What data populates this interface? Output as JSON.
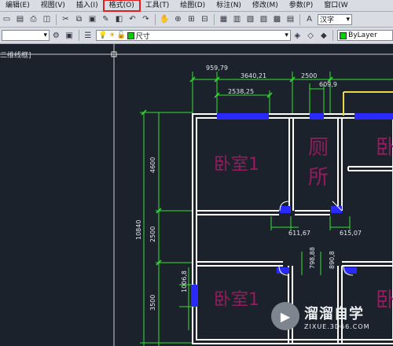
{
  "menu": {
    "items": [
      {
        "label": "编辑(E)"
      },
      {
        "label": "视图(V)"
      },
      {
        "label": "插入(I)"
      },
      {
        "label": "格式(O)"
      },
      {
        "label": "工具(T)"
      },
      {
        "label": "绘图(D)"
      },
      {
        "label": "标注(N)"
      },
      {
        "label": "修改(M)"
      },
      {
        "label": "参数(P)"
      },
      {
        "label": "窗口(W"
      }
    ]
  },
  "toolbar": {
    "text_style": "汉字",
    "layer": "尺寸",
    "color": "ByLayer"
  },
  "viewport": {
    "label": "二维线框]"
  },
  "dimensions": {
    "d1": "959,79",
    "d2": "3640,21",
    "d3": "2500",
    "d4": "609,9",
    "d5": "2538,25",
    "v4600": "4600",
    "v10840": "10840",
    "v2500": "2500",
    "v3500": "3500",
    "d611": "611,67",
    "d615": "615,07",
    "d798": "798,88",
    "d890": "890,8",
    "d1006": "1006,8"
  },
  "rooms": {
    "bedroom1": "卧室1",
    "bedroom2": "卧室1",
    "toilet_a": "厕",
    "toilet_b": "所"
  },
  "watermark": {
    "cn": "溜溜自学",
    "url": "ZIXUE.3D66.COM"
  },
  "colors": {
    "menu_highlight": "#e02020",
    "dim": "#32e132",
    "wall": "#ffffff",
    "door": "#2a2aff",
    "text": "#c21873",
    "canvas": "#1b222b"
  }
}
